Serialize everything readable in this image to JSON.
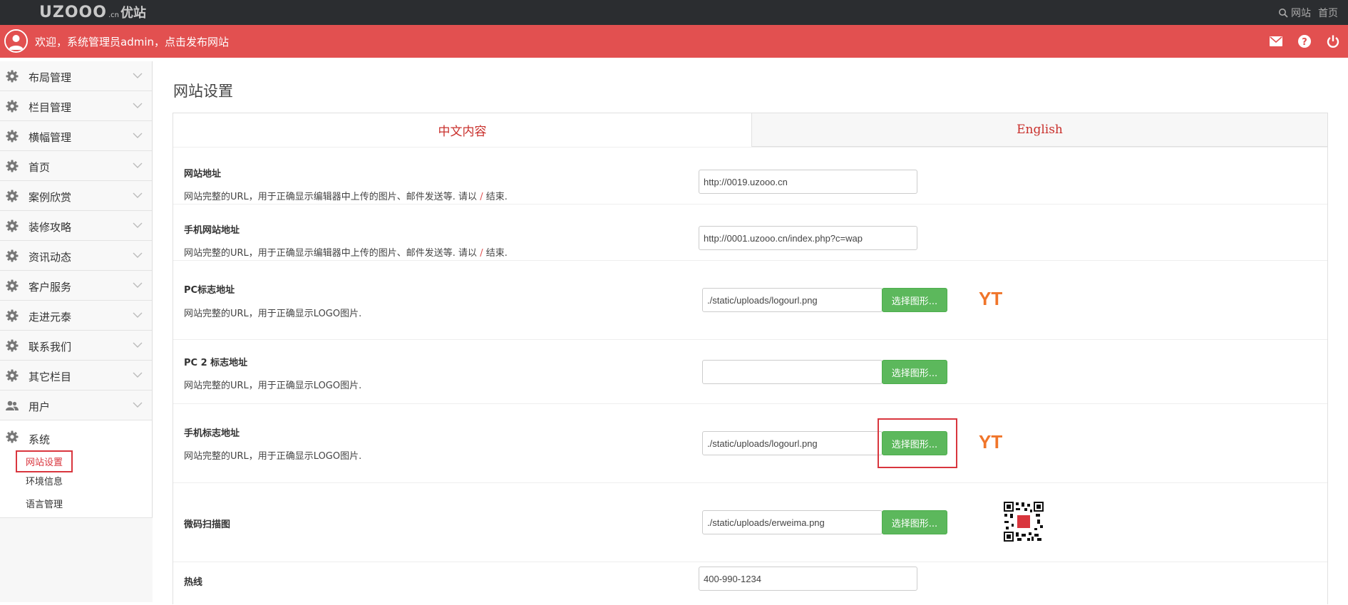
{
  "topbar": {
    "logo_main": "UZOOO",
    "logo_cn": ".cn",
    "logo_brand": "优站",
    "links": [
      "网站",
      "首页"
    ]
  },
  "redbar": {
    "welcome": "欢迎，系统管理员admin，点击发布网站"
  },
  "sidebar": {
    "items": [
      {
        "label": "布局管理",
        "icon": "gear-icon"
      },
      {
        "label": "栏目管理",
        "icon": "gear-icon"
      },
      {
        "label": "横幅管理",
        "icon": "gear-icon"
      },
      {
        "label": "首页",
        "icon": "gear-icon"
      },
      {
        "label": "案例欣赏",
        "icon": "gear-icon"
      },
      {
        "label": "装修攻略",
        "icon": "gear-icon"
      },
      {
        "label": "资讯动态",
        "icon": "gear-icon"
      },
      {
        "label": "客户服务",
        "icon": "gear-icon"
      },
      {
        "label": "走进元泰",
        "icon": "gear-icon"
      },
      {
        "label": "联系我们",
        "icon": "gear-icon"
      },
      {
        "label": "其它栏目",
        "icon": "gear-icon"
      },
      {
        "label": "用户",
        "icon": "users-icon"
      }
    ],
    "system": {
      "label": "系统",
      "subs": [
        "网站设置",
        "环境信息",
        "语言管理"
      ]
    }
  },
  "main": {
    "title": "网站设置",
    "tabs": [
      "中文内容",
      "English"
    ],
    "select_btn": "选择图形...",
    "yt": "YT",
    "rows": [
      {
        "label": "网站地址",
        "desc_pre": "网站完整的URL，用于正确显示编辑器中上传的图片、邮件发送等. 请以 ",
        "slash": "/",
        "desc_post": " 结束.",
        "value": "http://0019.uzooo.cn"
      },
      {
        "label": "手机网站地址",
        "desc_pre": "网站完整的URL，用于正确显示编辑器中上传的图片、邮件发送等. 请以 ",
        "slash": "/",
        "desc_post": " 结束.",
        "value": "http://0001.uzooo.cn/index.php?c=wap"
      },
      {
        "label": "PC标志地址",
        "desc": "网站完整的URL，用于正确显示LOGO图片.",
        "value": "./static/uploads/logourl.png"
      },
      {
        "label": "PC 2 标志地址",
        "desc": "网站完整的URL，用于正确显示LOGO图片.",
        "value": ""
      },
      {
        "label": "手机标志地址",
        "desc": "网站完整的URL，用于正确显示LOGO图片.",
        "value": "./static/uploads/logourl.png"
      },
      {
        "label": "微码扫描图",
        "value": "./static/uploads/erweima.png"
      },
      {
        "label": "热线",
        "value": "400-990-1234"
      }
    ]
  }
}
